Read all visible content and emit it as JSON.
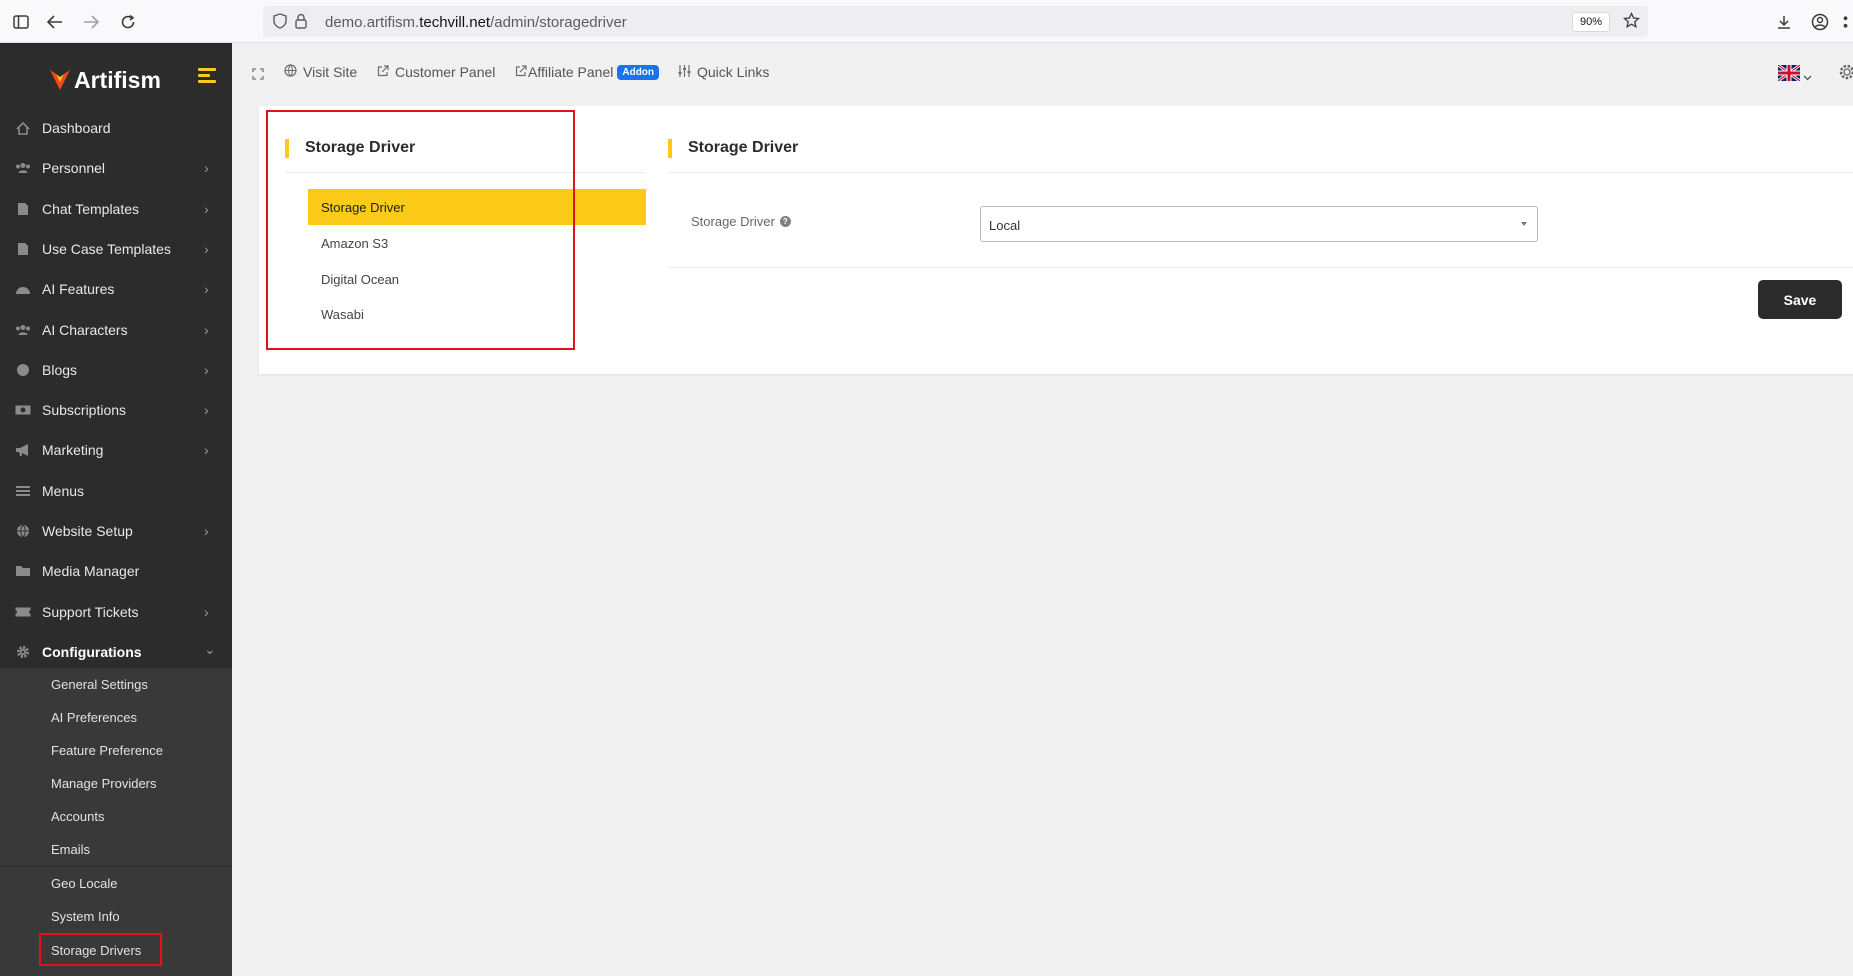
{
  "browser": {
    "url_prefix": "demo.artifism.",
    "url_host": "techvill.net",
    "url_path": "/admin/storagedriver",
    "zoom": "90%"
  },
  "sidebar": {
    "brand": "Artifism",
    "items": [
      {
        "label": "Dashboard",
        "icon": "home-icon",
        "chevron": ""
      },
      {
        "label": "Personnel",
        "icon": "users-icon",
        "chevron": "›"
      },
      {
        "label": "Chat Templates",
        "icon": "document-icon",
        "chevron": "›"
      },
      {
        "label": "Use Case Templates",
        "icon": "document-icon",
        "chevron": "›"
      },
      {
        "label": "AI Features",
        "icon": "gauge-icon",
        "chevron": "›"
      },
      {
        "label": "AI Characters",
        "icon": "users-icon",
        "chevron": "›"
      },
      {
        "label": "Blogs",
        "icon": "blog-icon",
        "chevron": "›"
      },
      {
        "label": "Subscriptions",
        "icon": "money-icon",
        "chevron": "›"
      },
      {
        "label": "Marketing",
        "icon": "megaphone-icon",
        "chevron": "›"
      },
      {
        "label": "Menus",
        "icon": "menu-icon",
        "chevron": ""
      },
      {
        "label": "Website Setup",
        "icon": "globe-icon",
        "chevron": "›"
      },
      {
        "label": "Media Manager",
        "icon": "folder-icon",
        "chevron": ""
      },
      {
        "label": "Support Tickets",
        "icon": "ticket-icon",
        "chevron": "›"
      },
      {
        "label": "Configurations",
        "icon": "gear-icon",
        "chevron": "⌄"
      }
    ],
    "config_sub": [
      {
        "label": "General Settings"
      },
      {
        "label": "AI Preferences"
      },
      {
        "label": "Feature Preference"
      },
      {
        "label": "Manage Providers"
      },
      {
        "label": "Accounts"
      },
      {
        "label": "Emails"
      },
      {
        "label": "Geo Locale"
      },
      {
        "label": "System Info"
      },
      {
        "label": "Storage Drivers"
      }
    ]
  },
  "topbar": {
    "visit_site": "Visit Site",
    "customer_panel": "Customer Panel",
    "affiliate_panel": "Affiliate Panel",
    "addon_badge": "Addon",
    "quick_links": "Quick Links"
  },
  "left_panel": {
    "title": "Storage Driver",
    "items": [
      {
        "label": "Storage Driver"
      },
      {
        "label": "Amazon S3"
      },
      {
        "label": "Digital Ocean"
      },
      {
        "label": "Wasabi"
      }
    ]
  },
  "right_panel": {
    "title": "Storage Driver",
    "field_label": "Storage Driver",
    "select_value": "Local",
    "save_label": "Save"
  },
  "colors": {
    "accent": "#fcca19",
    "sidebar_bg": "#2c2c2c",
    "highlight_border": "#e0131c",
    "addon_blue": "#1a73e8"
  }
}
